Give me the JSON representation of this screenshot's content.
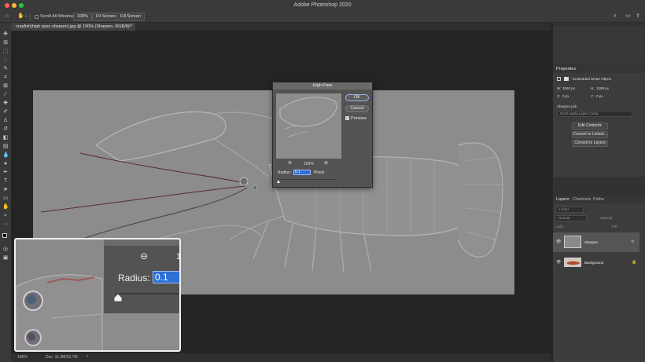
{
  "window": {
    "title": "Adobe Photoshop 2020"
  },
  "options_bar": {
    "scroll_all_windows": "Scroll All Windows",
    "zoom_percent": "100%",
    "fit_screen": "Fit Screen",
    "fill_screen": "Fill Screen"
  },
  "document": {
    "tab_title": "crayfish(high pass sharpen).jpg @ 100% (Sharpen, RGB/8) *"
  },
  "status": {
    "zoom": "100%",
    "doc_size": "Doc: 11.3M/23.7M"
  },
  "high_pass": {
    "title": "High Pass",
    "ok": "OK",
    "cancel": "Cancel",
    "preview_label": "Preview",
    "preview_checked": true,
    "zoom": "100%",
    "radius_label": "Radius:",
    "radius_value": "0.1",
    "units": "Pixels"
  },
  "inset": {
    "radius_label": "Radius:",
    "radius_value": "0.1",
    "partial_zoom_text": "1"
  },
  "properties": {
    "tab": "Properties",
    "object_type": "Embedded Smart Object",
    "w_label": "W:",
    "w_value": "3060 px",
    "h_label": "H:",
    "h_value": "1298 px",
    "x_label": "X:",
    "x_value": "0 px",
    "y_label": "Y:",
    "y_value": "0 px",
    "filename": "Sharpen.psb",
    "layer_comp": "Don't Apply Layer Comp",
    "edit_contents": "Edit Contents",
    "convert_linked": "Convert to Linked...",
    "convert_layers": "Convert to Layers"
  },
  "layers": {
    "tabs": [
      "Layers",
      "Channels",
      "Paths"
    ],
    "filter_kind": "Kind",
    "blend_mode": "Normal",
    "opacity_label": "Opacity:",
    "lock_label": "Lock:",
    "fill_label": "Fill:",
    "items": [
      {
        "name": "Sharpen",
        "selected": true
      },
      {
        "name": "Background",
        "selected": false
      }
    ]
  },
  "colors": {
    "accent": "#2f6fd6",
    "canvas_gray": "#8c8c8c",
    "dialog_bg": "#535353"
  }
}
